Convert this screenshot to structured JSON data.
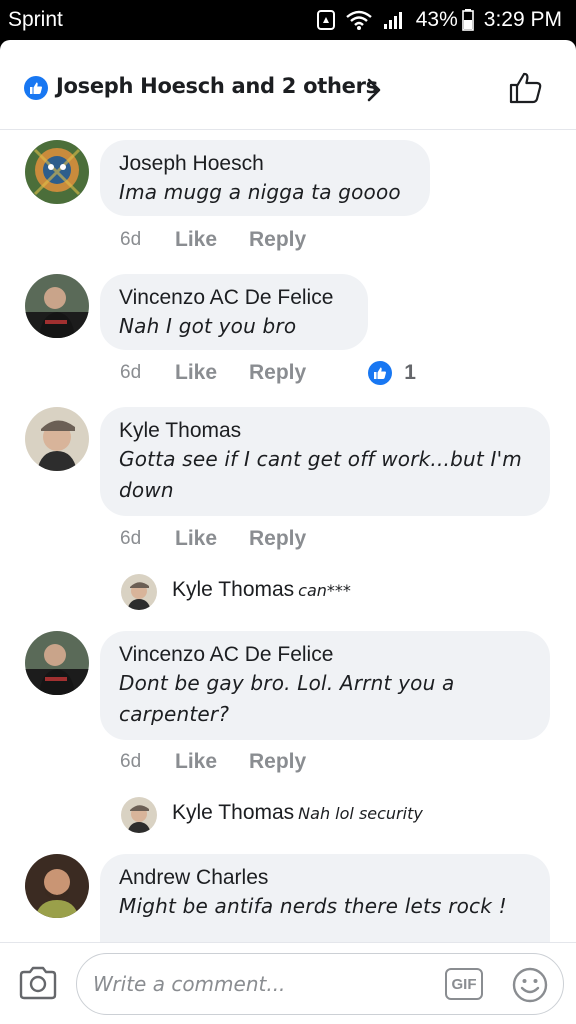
{
  "status_bar": {
    "carrier": "Sprint",
    "battery_percent": "43%",
    "time": "3:29 PM"
  },
  "header": {
    "likers_text": "Joseph Hoesch and 2 others"
  },
  "comments": [
    {
      "author": "Joseph Hoesch",
      "text": "Ima mugg a nigga ta goooo",
      "time": "6d",
      "like_label": "Like",
      "reply_label": "Reply"
    },
    {
      "author": "Vincenzo AC De Felice",
      "text": "Nah I got you bro",
      "time": "6d",
      "like_label": "Like",
      "reply_label": "Reply",
      "reaction_count": "1"
    },
    {
      "author": "Kyle Thomas",
      "text": "Gotta see if I cant get off work...but I'm down",
      "time": "6d",
      "like_label": "Like",
      "reply_label": "Reply",
      "reply_preview": {
        "author": "Kyle Thomas",
        "text": "can***"
      }
    },
    {
      "author": "Vincenzo AC De Felice",
      "text": "Dont be gay bro. Lol. Arrnt you a carpenter?",
      "time": "6d",
      "like_label": "Like",
      "reply_label": "Reply",
      "reply_preview": {
        "author": "Kyle Thomas",
        "text": "Nah lol security"
      }
    },
    {
      "author": "Andrew Charles",
      "text": "Might be antifa nerds there lets rock !"
    }
  ],
  "composer": {
    "placeholder": "Write a comment...",
    "gif_label": "GIF"
  },
  "colors": {
    "accent": "#1877f2",
    "bubble": "#f0f2f5",
    "meta_text": "#8a8d91"
  }
}
